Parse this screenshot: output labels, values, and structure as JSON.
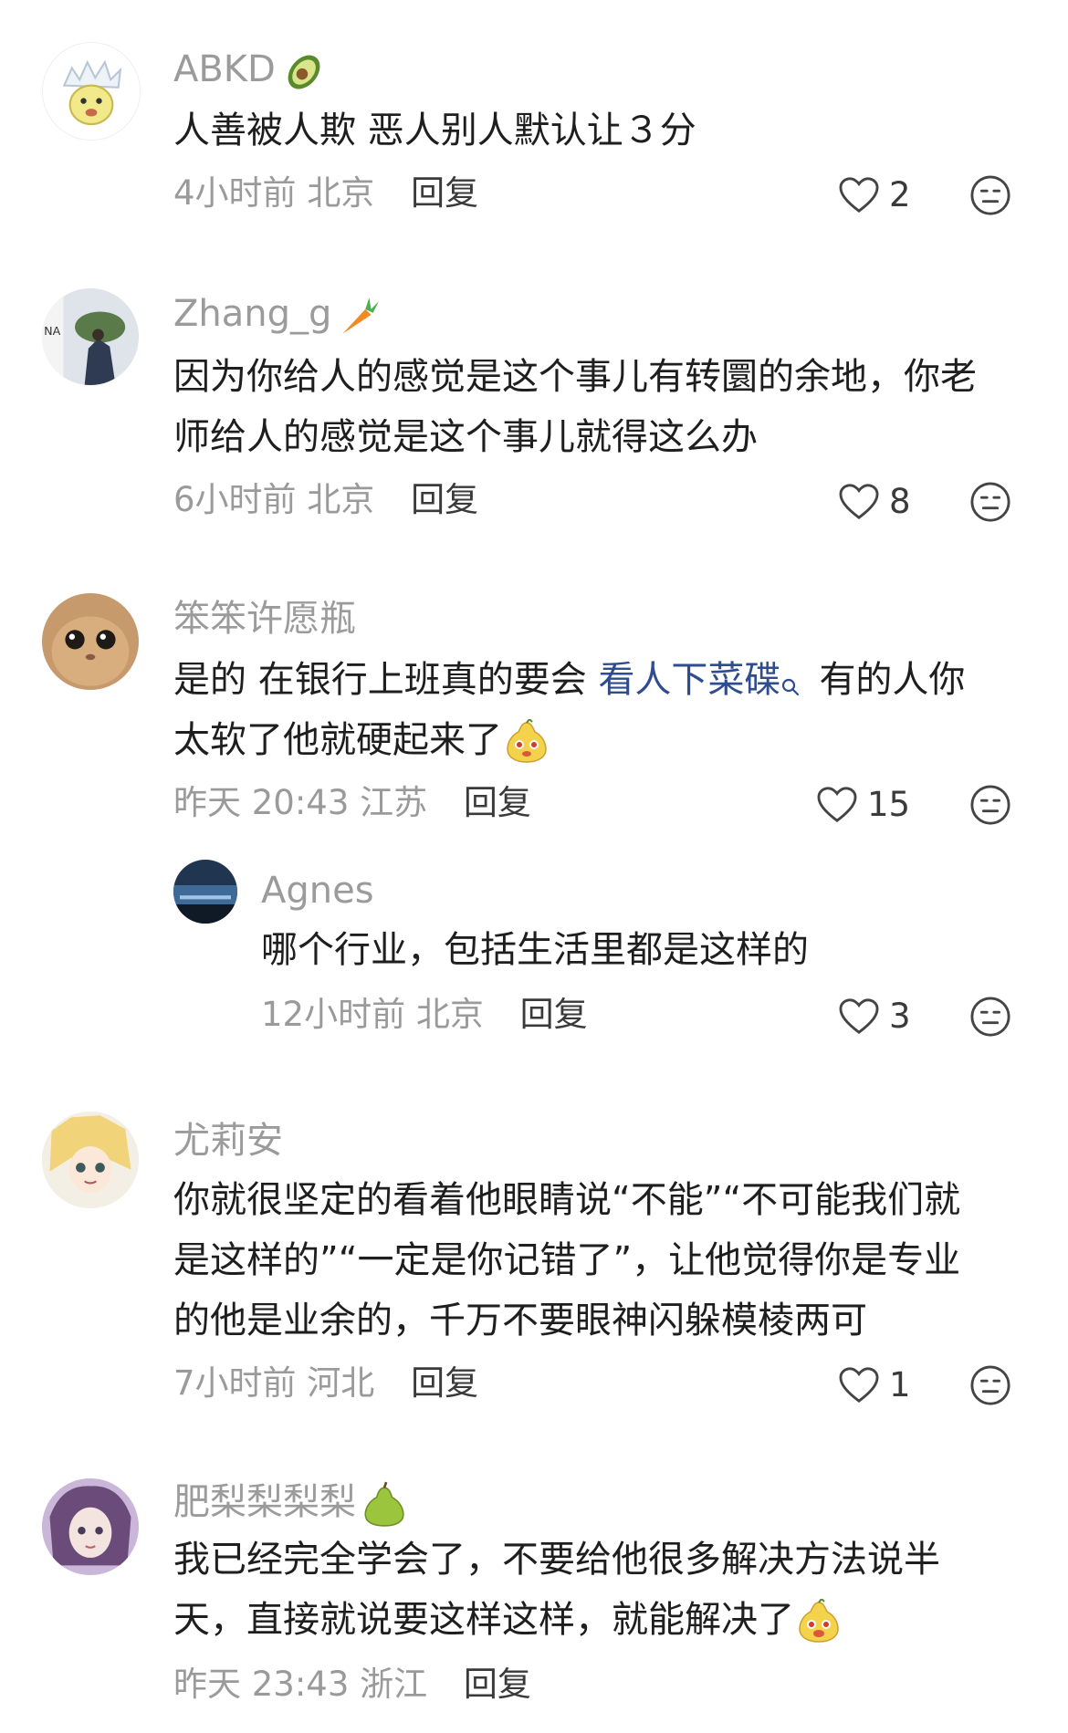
{
  "comments": [
    {
      "username": "ABKD",
      "name_emoji": "avocado-icon",
      "lines": [
        "人善被人欺 恶人别人默认让３分"
      ],
      "time": "4小时前",
      "location": "北京",
      "reply_label": "回复",
      "likes": "2"
    },
    {
      "username": "Zhang_g",
      "name_emoji": "carrot-icon",
      "lines": [
        "因为你给人的感觉是这个事儿有转圜的余地，你老",
        "师给人的感觉是这个事儿就得这么办"
      ],
      "time": "6小时前",
      "location": "北京",
      "reply_label": "回复",
      "likes": "8"
    },
    {
      "username": "笨笨许愿瓶",
      "line1_pre": "是的 在银行上班真的要会 ",
      "line1_link": "看人下菜碟",
      "line1_post": "有的人你",
      "line2": "太软了他就硬起来了",
      "time": "昨天 20:43",
      "location": "江苏",
      "reply_label": "回复",
      "likes": "15"
    },
    {
      "username": "Agnes",
      "lines": [
        "哪个行业，包括生活里都是这样的"
      ],
      "time": "12小时前",
      "location": "北京",
      "reply_label": "回复",
      "likes": "3"
    },
    {
      "username": "尤莉安",
      "lines": [
        "你就很坚定的看着他眼睛说“不能”“不可能我们就",
        "是这样的”“一定是你记错了”，让他觉得你是专业",
        "的他是业余的，千万不要眼神闪躲模棱两可"
      ],
      "time": "7小时前",
      "location": "河北",
      "reply_label": "回复",
      "likes": "1"
    },
    {
      "username": "肥梨梨梨梨",
      "name_emoji": "pear-icon",
      "line1": "我已经完全学会了，不要给他很多解决方法说半",
      "line2": "天，直接就说要这样这样，就能解决了",
      "time": "昨天 23:43",
      "location": "浙江",
      "reply_label": "回复"
    }
  ],
  "colors": {
    "username": "#9b9b9b",
    "link": "#2f4c8f",
    "meta": "#9a9a9a",
    "icon": "#444444"
  }
}
